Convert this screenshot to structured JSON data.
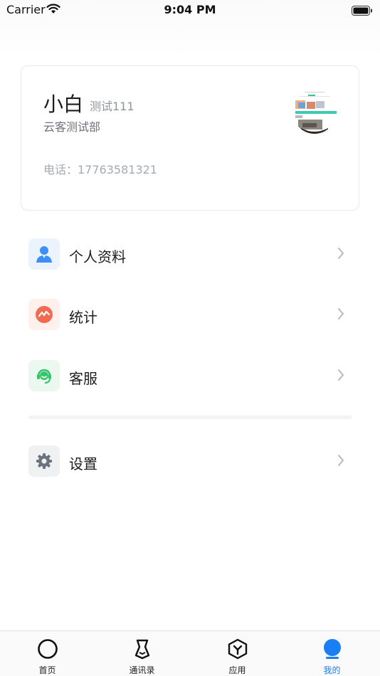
{
  "status_bar": {
    "carrier": "Carrier",
    "time": "9:04 PM"
  },
  "profile": {
    "name": "小白",
    "user_id": "测试111",
    "department": "云客测试部",
    "phone": "电话：17763581321"
  },
  "menu": {
    "items": [
      {
        "label": "个人资料",
        "icon": "person-icon",
        "color": "#3d8ef7",
        "bg": "#eaf3fe"
      },
      {
        "label": "统计",
        "icon": "stats-icon",
        "color": "#f26b50",
        "bg": "#fef0ec"
      },
      {
        "label": "客服",
        "icon": "headset-icon",
        "color": "#34c46a",
        "bg": "#eaf8ef"
      },
      {
        "label": "设置",
        "icon": "gear-icon",
        "color": "#6b7280",
        "bg": "#f0f1f3"
      }
    ]
  },
  "tabs": [
    {
      "label": "首页",
      "icon": "circle-icon"
    },
    {
      "label": "通讯录",
      "icon": "contacts-icon"
    },
    {
      "label": "应用",
      "icon": "apps-hexagon-icon"
    },
    {
      "label": "我的",
      "icon": "profile-icon",
      "active": true
    }
  ],
  "colors": {
    "accent": "#1a7ef5"
  }
}
